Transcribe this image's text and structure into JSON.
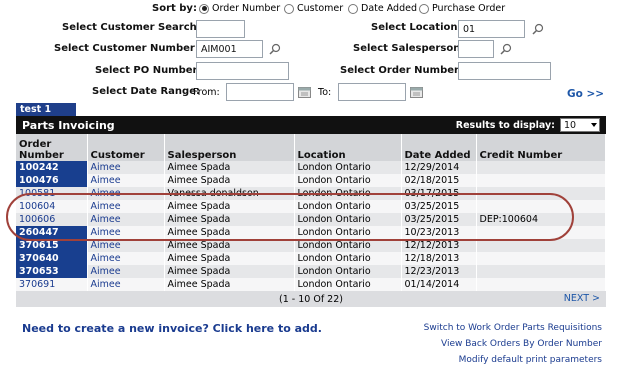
{
  "sort": {
    "label": "Sort by:",
    "options": [
      "Order Number",
      "Customer",
      "Date Added",
      "Purchase Order"
    ],
    "selected": 0
  },
  "filters": {
    "customer_search_label": "Select Customer Search:",
    "customer_search_value": "",
    "location_label": "Select Location:",
    "location_value": "01",
    "customer_number_label": "Select Customer Number:",
    "customer_number_value": "AIM001",
    "salesperson_label": "Select Salesperson:",
    "salesperson_value": "",
    "po_number_label": "Select PO Number:",
    "po_number_value": "",
    "order_number_label": "Select Order Number:",
    "order_number_value": "",
    "date_range_label": "Select Date Range:",
    "from_label": "From:",
    "from_value": "",
    "to_label": "To:",
    "to_value": "",
    "go_label": "Go >>"
  },
  "grid": {
    "tab_label": "test 1",
    "title": "Parts Invoicing",
    "results_label": "Results to display:",
    "results_value": "10",
    "columns": [
      "Order Number",
      "Customer",
      "Salesperson",
      "Location",
      "Date Added",
      "Credit Number"
    ],
    "rows": [
      {
        "order": "100242",
        "customer": "Aimee",
        "salesperson": "Aimee Spada",
        "location": "London Ontario",
        "date": "12/29/2014",
        "credit": ""
      },
      {
        "order": "100476",
        "customer": "Aimee",
        "salesperson": "Aimee Spada",
        "location": "London Ontario",
        "date": "02/18/2015",
        "credit": ""
      },
      {
        "order": "100581",
        "customer": "Aimee",
        "salesperson": "Vanessa donaldson",
        "location": "London Ontario",
        "date": "03/17/2015",
        "credit": ""
      },
      {
        "order": "100604",
        "customer": "Aimee",
        "salesperson": "Aimee Spada",
        "location": "London Ontario",
        "date": "03/25/2015",
        "credit": ""
      },
      {
        "order": "100606",
        "customer": "Aimee",
        "salesperson": "Aimee Spada",
        "location": "London Ontario",
        "date": "03/25/2015",
        "credit": "DEP:100604"
      },
      {
        "order": "260447",
        "customer": "Aimee",
        "salesperson": "Aimee Spada",
        "location": "London Ontario",
        "date": "10/23/2013",
        "credit": ""
      },
      {
        "order": "370615",
        "customer": "Aimee",
        "salesperson": "Aimee Spada",
        "location": "London Ontario",
        "date": "12/12/2013",
        "credit": ""
      },
      {
        "order": "370640",
        "customer": "Aimee",
        "salesperson": "Aimee Spada",
        "location": "London Ontario",
        "date": "12/18/2013",
        "credit": ""
      },
      {
        "order": "370653",
        "customer": "Aimee",
        "salesperson": "Aimee Spada",
        "location": "London Ontario",
        "date": "12/23/2013",
        "credit": ""
      },
      {
        "order": "370691",
        "customer": "Aimee",
        "salesperson": "Aimee Spada",
        "location": "London Ontario",
        "date": "01/14/2014",
        "credit": ""
      }
    ],
    "pager_text": "(1 - 10 Of 22)",
    "next_label": "NEXT >"
  },
  "footer": {
    "need_invoice": "Need to create a new invoice? Click here to add.",
    "links": [
      "Switch to Work Order Parts Requisitions",
      "View Back Orders By Order Number",
      "Modify default print parameters"
    ]
  },
  "colors": {
    "accent": "#1f3f8a",
    "link": "#1a3b8f",
    "annotation": "#a0413a"
  }
}
